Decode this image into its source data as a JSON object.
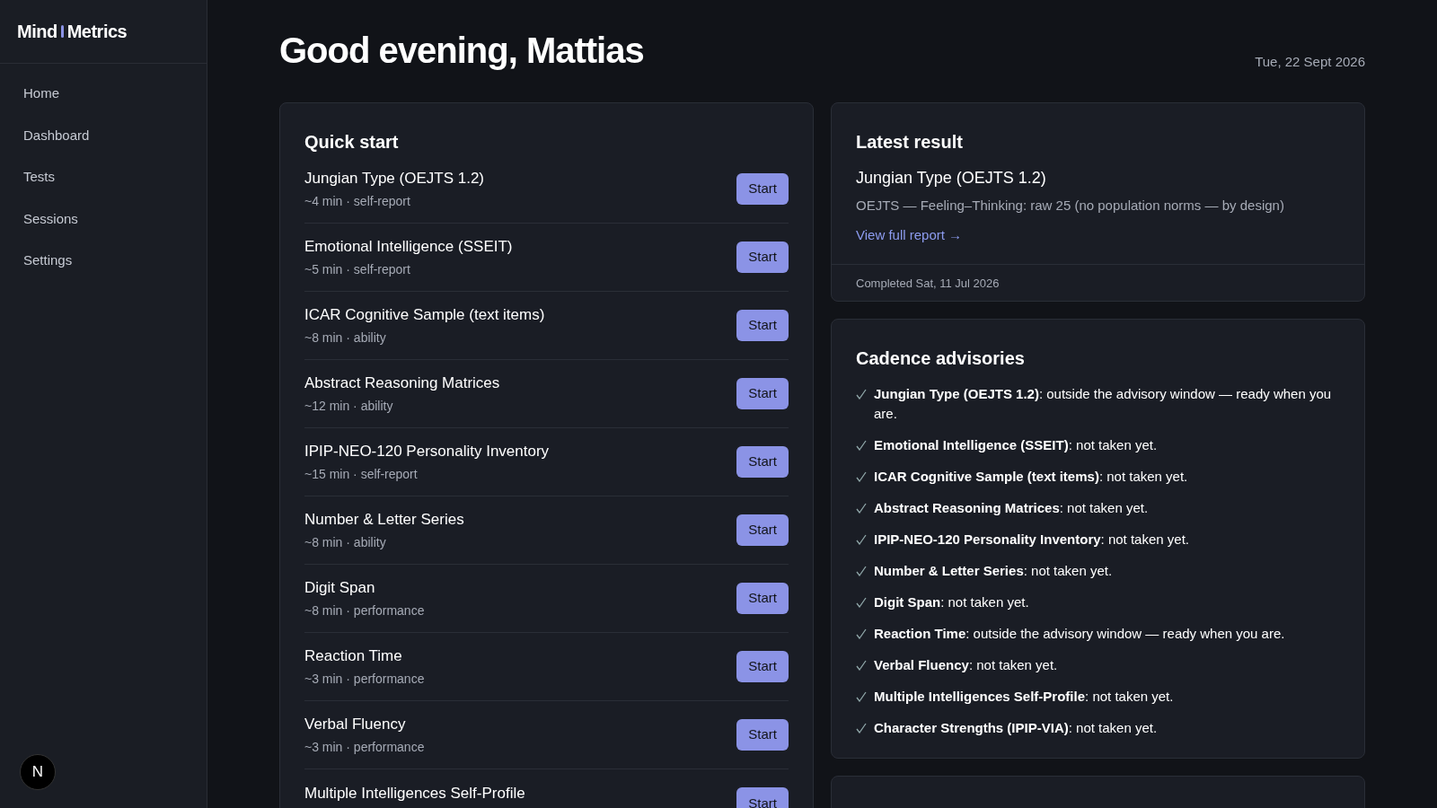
{
  "sidebar": {
    "logo": [
      "Mind",
      "Metrics"
    ],
    "items": [
      {
        "label": "Home"
      },
      {
        "label": "Dashboard"
      },
      {
        "label": "Tests"
      },
      {
        "label": "Sessions"
      },
      {
        "label": "Settings"
      }
    ],
    "badge": "N"
  },
  "header": {
    "greeting": "Good evening, Mattias",
    "date": "Tue, 22 Sept 2026"
  },
  "quick_start": {
    "title": "Quick start",
    "tests": [
      {
        "name": "Jungian Type (OEJTS 1.2)",
        "meta": "~4 min · self-report",
        "button": "Start"
      },
      {
        "name": "Emotional Intelligence (SSEIT)",
        "meta": "~5 min · self-report",
        "button": "Start"
      },
      {
        "name": "ICAR Cognitive Sample (text items)",
        "meta": "~8 min · ability",
        "button": "Start"
      },
      {
        "name": "Abstract Reasoning Matrices",
        "meta": "~12 min · ability",
        "button": "Start"
      },
      {
        "name": "IPIP-NEO-120 Personality Inventory",
        "meta": "~15 min · self-report",
        "button": "Start"
      },
      {
        "name": "Number & Letter Series",
        "meta": "~8 min · ability",
        "button": "Start"
      },
      {
        "name": "Digit Span",
        "meta": "~8 min · performance",
        "button": "Start"
      },
      {
        "name": "Reaction Time",
        "meta": "~3 min · performance",
        "button": "Start"
      },
      {
        "name": "Verbal Fluency",
        "meta": "~3 min · performance",
        "button": "Start"
      },
      {
        "name": "Multiple Intelligences Self-Profile",
        "button": "Start"
      }
    ]
  },
  "latest_result": {
    "title": "Latest result",
    "test": "Jungian Type (OEJTS 1.2)",
    "summary": "OEJTS — Feeling–Thinking: raw 25 (no population norms — by design)",
    "link": "View full report →",
    "completed": "Completed Sat, 11 Jul 2026"
  },
  "cadence": {
    "title": "Cadence advisories",
    "items": [
      "**Jungian Type (OEJTS 1.2)**: outside the advisory window — ready when you are.",
      "**Emotional Intelligence (SSEIT)**: not taken yet.",
      "**ICAR Cognitive Sample (text items)**: not taken yet.",
      "**Abstract Reasoning Matrices**: not taken yet.",
      "**IPIP-NEO-120 Personality Inventory**: not taken yet.",
      "**Number & Letter Series**: not taken yet.",
      "**Digit Span**: not taken yet.",
      "**Reaction Time**: outside the advisory window — ready when you are.",
      "**Verbal Fluency**: not taken yet.",
      "**Multiple Intelligences Self-Profile**: not taken yet.",
      "**Character Strengths (IPIP-VIA)**: not taken yet."
    ]
  }
}
